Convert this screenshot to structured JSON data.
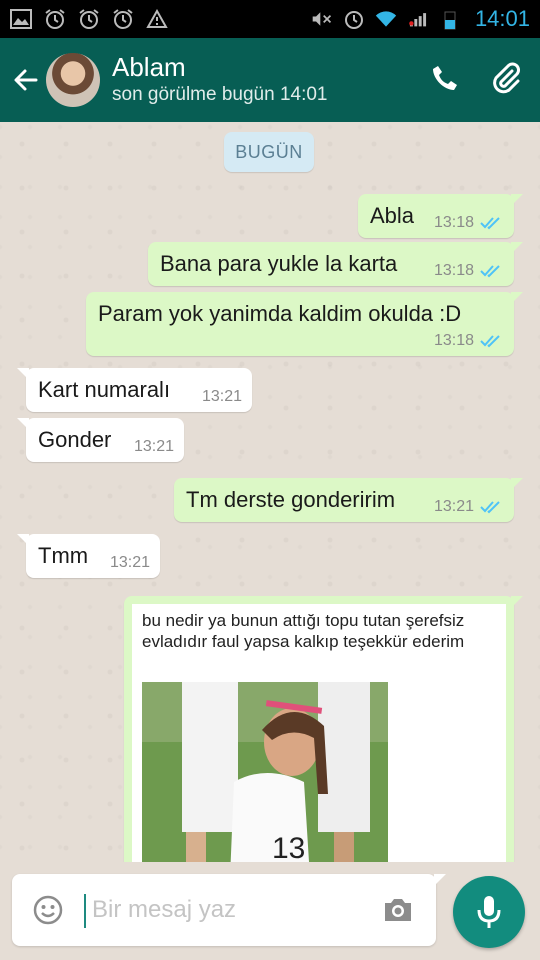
{
  "status_bar": {
    "time": "14:01"
  },
  "header": {
    "contact_name": "Ablam",
    "last_seen": "son görülme bugün 14:01"
  },
  "chat": {
    "date_label": "BUGÜN",
    "messages": [
      {
        "direction": "outgoing",
        "text": "Abla",
        "time": "13:18",
        "status": "read"
      },
      {
        "direction": "outgoing",
        "text": "Bana para yukle la karta",
        "time": "13:18",
        "status": "read"
      },
      {
        "direction": "outgoing",
        "text": "Param yok yanimda kaldim okulda :D",
        "time": "13:18",
        "status": "read"
      },
      {
        "direction": "incoming",
        "text": "Kart numaralı",
        "time": "13:21"
      },
      {
        "direction": "incoming",
        "text": "Gonder",
        "time": "13:21"
      },
      {
        "direction": "outgoing",
        "text": "Tm derste gonderirim",
        "time": "13:21",
        "status": "read"
      },
      {
        "direction": "incoming",
        "text": "Tmm",
        "time": "13:21"
      }
    ],
    "image_message": {
      "direction": "outgoing",
      "caption": "bu nedir ya bunun attığı topu tutan şerefsiz evladıdır faul yapsa kalkıp teşekkür ederim",
      "jersey_number": "13"
    }
  },
  "composer": {
    "placeholder": "Bir mesaj yaz"
  },
  "colors": {
    "header": "#075e54",
    "outgoing_bubble": "#dcf8c6",
    "incoming_bubble": "#ffffff",
    "read_ticks": "#4fc3f7",
    "fab": "#128c7e"
  },
  "icons": [
    "gallery-icon",
    "alarm-icon",
    "warning-icon",
    "mute-icon",
    "wifi-icon",
    "signal-icon",
    "battery-icon",
    "back-arrow-icon",
    "phone-icon",
    "attach-icon",
    "read-ticks-icon",
    "emoji-icon",
    "camera-icon",
    "mic-icon"
  ]
}
